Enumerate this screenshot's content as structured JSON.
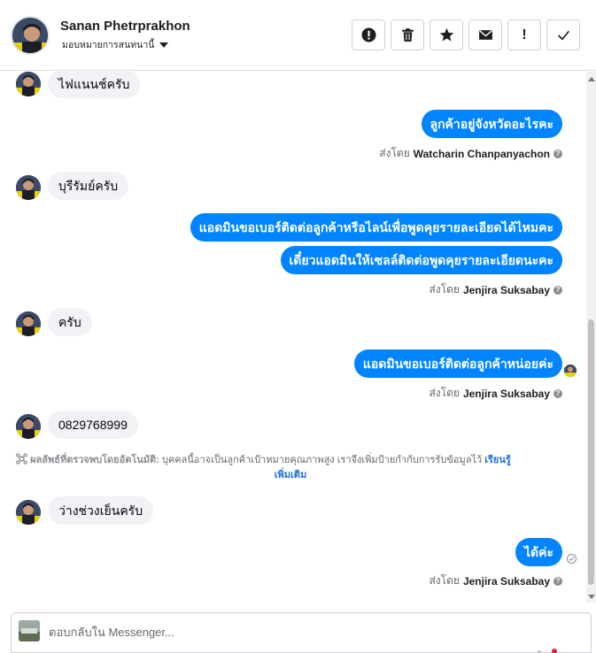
{
  "header": {
    "contact_name": "Sanan Phetrprakhon",
    "assignment": "มอบหมายการสนทนานี้",
    "actions": [
      {
        "name": "report-icon",
        "label": ""
      },
      {
        "name": "trash-icon",
        "label": ""
      },
      {
        "name": "star-icon",
        "label": ""
      },
      {
        "name": "mail-icon",
        "label": ""
      },
      {
        "name": "exclamation-icon",
        "label": "!"
      },
      {
        "name": "check-icon",
        "label": ""
      }
    ]
  },
  "messages": {
    "m1": "ไฟแนนช์ครับ",
    "m2": "ลูกค้าอยู่จังหวัดอะไรคะ",
    "m2_sent_prefix": "ส่งโดย",
    "m2_sender": "Watcharin Chanpanyachon",
    "m3": "บุรีรัมย์ครับ",
    "m4": "แอดมินขอเบอร์ติดต่อลูกค้าหรือไลน์เพื่อพูดคุยรายละเอียดได้ไหมคะ",
    "m5": "เดี๋ยวแอดมินให้เซลล์ติดต่อพูดคุยรายละเอียดนะคะ",
    "m5_sent_prefix": "ส่งโดย",
    "m5_sender": "Jenjira Suksabay",
    "m6": "ครับ",
    "m7": "แอดมินขอเบอร์ติดต่อลูกค้าหน่อยค่ะ",
    "m7_sent_prefix": "ส่งโดย",
    "m7_sender": "Jenjira Suksabay",
    "m8": "0829768999",
    "ai_label": "ผลลัพธ์ที่ตรวจพบโดยอัตโนมัติ:",
    "ai_text": "บุคคลนี้อาจเป็นลูกค้าเป้าหมายคุณภาพสูง เราจึงเพิ่มป้ายกำกับการรับข้อมูลไว้",
    "ai_link_1": "เรียนรู้",
    "ai_link_2": "เพิ่มเติม",
    "m9": "ว่างช่วงเย็นครับ",
    "m10": "ได้ค่ะ",
    "m10_sent_prefix": "ส่งโดย",
    "m10_sender": "Jenjira Suksabay"
  },
  "reply": {
    "placeholder": "ตอบกลับใน Messenger..."
  },
  "colors": {
    "outgoing_bubble": "#0084ff",
    "incoming_bubble": "#f0f2f5",
    "link": "#216fdb"
  }
}
